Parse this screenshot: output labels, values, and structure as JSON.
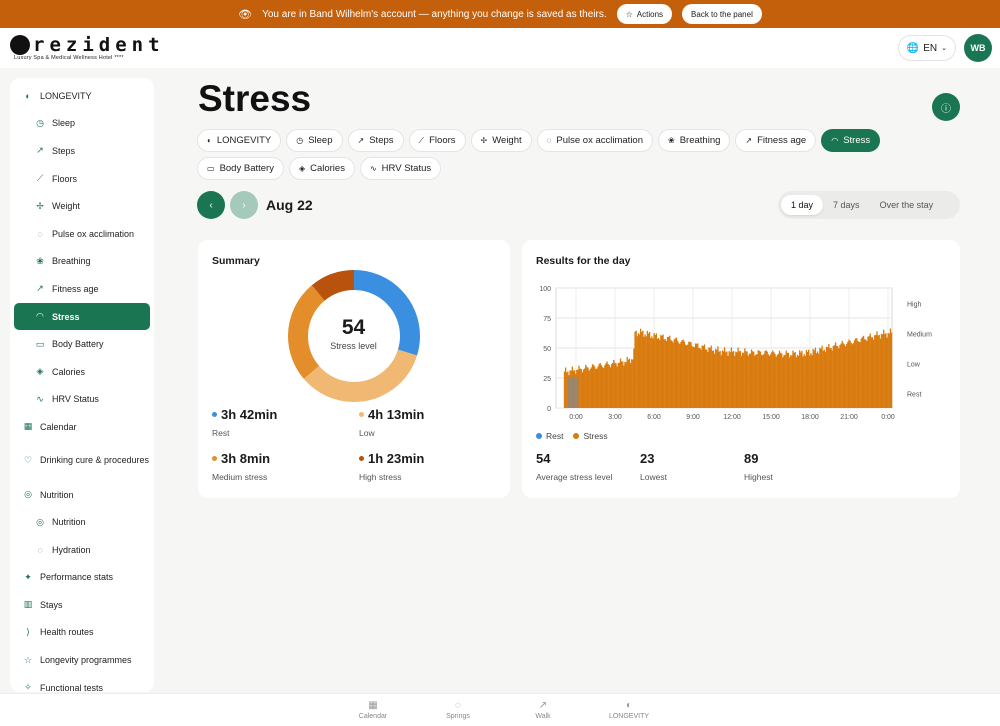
{
  "banner": {
    "message": "You are in Band Wilhelm's account — anything you change is saved as theirs.",
    "actions_label": "Actions",
    "back_label": "Back to the panel"
  },
  "header": {
    "logo_text": "rezident",
    "logo_sub": "Luxury Spa & Medical Wellness Hotel ****",
    "language": "EN",
    "avatar": "WB"
  },
  "sidebar": {
    "items": [
      {
        "label": "LONGEVITY",
        "icon": "longevity-icon",
        "glyph": "◐",
        "sub": false
      },
      {
        "label": "Sleep",
        "icon": "clock-icon",
        "glyph": "◷",
        "sub": true
      },
      {
        "label": "Steps",
        "icon": "walk-icon",
        "glyph": "↗",
        "sub": true
      },
      {
        "label": "Floors",
        "icon": "stairs-icon",
        "glyph": "⟋",
        "sub": true
      },
      {
        "label": "Weight",
        "icon": "weight-icon",
        "glyph": "✢",
        "sub": true
      },
      {
        "label": "Pulse ox acclimation",
        "icon": "drop-icon",
        "glyph": "◌",
        "sub": true
      },
      {
        "label": "Breathing",
        "icon": "lungs-icon",
        "glyph": "❀",
        "sub": true
      },
      {
        "label": "Fitness age",
        "icon": "runner-icon",
        "glyph": "↗",
        "sub": true
      },
      {
        "label": "Stress",
        "icon": "gauge-icon",
        "glyph": "◠",
        "sub": true,
        "active": true
      },
      {
        "label": "Body Battery",
        "icon": "battery-icon",
        "glyph": "▭",
        "sub": true
      },
      {
        "label": "Calories",
        "icon": "flame-icon",
        "glyph": "◈",
        "sub": true
      },
      {
        "label": "HRV Status",
        "icon": "pulse-icon",
        "glyph": "∿",
        "sub": true
      },
      {
        "label": "Calendar",
        "icon": "calendar-icon",
        "glyph": "▦",
        "sub": false
      },
      {
        "label": "Drinking cure & procedures",
        "icon": "heart-icon",
        "glyph": "♡",
        "sub": false,
        "two": true
      },
      {
        "label": "Nutrition",
        "icon": "target-icon",
        "glyph": "◎",
        "sub": false
      },
      {
        "label": "Nutrition",
        "icon": "target-icon",
        "glyph": "◎",
        "sub": true
      },
      {
        "label": "Hydration",
        "icon": "drop-icon",
        "glyph": "◌",
        "sub": true
      },
      {
        "label": "Performance stats",
        "icon": "sparkle-icon",
        "glyph": "✦",
        "sub": false
      },
      {
        "label": "Stays",
        "icon": "hotel-icon",
        "glyph": "▥",
        "sub": false
      },
      {
        "label": "Health routes",
        "icon": "route-icon",
        "glyph": "⟩",
        "sub": false
      },
      {
        "label": "Longevity programmes",
        "icon": "star-icon",
        "glyph": "☆",
        "sub": false
      },
      {
        "label": "Functional tests",
        "icon": "flask-icon",
        "glyph": "✧",
        "sub": false
      }
    ]
  },
  "page": {
    "title": "Stress",
    "date": "Aug 22",
    "period_tabs": [
      "1 day",
      "7 days",
      "Over the stay"
    ],
    "active_period": 0
  },
  "chips": [
    {
      "label": "LONGEVITY",
      "glyph": "◐"
    },
    {
      "label": "Sleep",
      "glyph": "◷"
    },
    {
      "label": "Steps",
      "glyph": "↗"
    },
    {
      "label": "Floors",
      "glyph": "⟋"
    },
    {
      "label": "Weight",
      "glyph": "✢"
    },
    {
      "label": "Pulse ox acclimation",
      "glyph": "◌"
    },
    {
      "label": "Breathing",
      "glyph": "❀"
    },
    {
      "label": "Fitness age",
      "glyph": "↗"
    },
    {
      "label": "Stress",
      "glyph": "◠",
      "active": true
    },
    {
      "label": "Body Battery",
      "glyph": "▭"
    },
    {
      "label": "Calories",
      "glyph": "◈"
    },
    {
      "label": "HRV Status",
      "glyph": "∿"
    }
  ],
  "summary": {
    "title": "Summary",
    "stress_level": "54",
    "stress_label": "Stress level",
    "segments": [
      {
        "name": "Rest",
        "minutes": 222,
        "color": "#3a8fe0",
        "value": "3h 42min"
      },
      {
        "name": "Low",
        "minutes": 253,
        "color": "#f0b872",
        "value": "4h 13min"
      },
      {
        "name": "Medium stress",
        "minutes": 188,
        "color": "#e38e2a",
        "value": "3h 8min"
      },
      {
        "name": "High stress",
        "minutes": 83,
        "color": "#b8520d",
        "value": "1h 23min"
      }
    ]
  },
  "results": {
    "title": "Results for the day",
    "legend": [
      {
        "name": "Rest",
        "color": "#3a8fe0"
      },
      {
        "name": "Stress",
        "color": "#d97b0e"
      }
    ],
    "stats": [
      {
        "value": "54",
        "label": "Average stress level"
      },
      {
        "value": "23",
        "label": "Lowest"
      },
      {
        "value": "89",
        "label": "Highest"
      }
    ]
  },
  "chart_data": {
    "type": "bar",
    "title": "Results for the day",
    "x_ticks": [
      "0:00",
      "3:00",
      "6:00",
      "9:00",
      "12:00",
      "15:00",
      "18:00",
      "21:00",
      "0:00"
    ],
    "y_ticks": [
      0,
      25,
      50,
      75,
      100
    ],
    "ylim": [
      0,
      100
    ],
    "right_labels": [
      "High",
      "Medium",
      "Low",
      "Rest"
    ],
    "grid": true,
    "series": [
      {
        "name": "Stress",
        "color": "#d97b0e",
        "profile": [
          [
            0.5,
            30
          ],
          [
            1.0,
            31
          ],
          [
            2.0,
            33
          ],
          [
            3.0,
            35
          ],
          [
            4.0,
            37
          ],
          [
            5.0,
            39
          ],
          [
            5.5,
            42
          ],
          [
            5.6,
            63
          ],
          [
            6.0,
            63
          ],
          [
            7.0,
            60
          ],
          [
            8.0,
            58
          ],
          [
            9.0,
            55
          ],
          [
            10.0,
            52
          ],
          [
            11.0,
            49
          ],
          [
            12.0,
            47
          ],
          [
            13.0,
            47
          ],
          [
            14.0,
            46
          ],
          [
            15.0,
            46
          ],
          [
            16.0,
            45
          ],
          [
            17.0,
            45
          ],
          [
            18.0,
            46
          ],
          [
            19.0,
            49
          ],
          [
            20.0,
            52
          ],
          [
            21.0,
            55
          ],
          [
            22.0,
            58
          ],
          [
            23.0,
            61
          ],
          [
            24.0,
            63
          ]
        ]
      },
      {
        "name": "Rest",
        "color": "#888888",
        "profile": [
          [
            0.8,
            25
          ],
          [
            1.6,
            25
          ]
        ]
      }
    ]
  },
  "bottom_tabs": [
    {
      "label": "Calendar",
      "glyph": "▦"
    },
    {
      "label": "Springs",
      "glyph": "◌"
    },
    {
      "label": "Walk",
      "glyph": "↗"
    },
    {
      "label": "LONGEVITY",
      "glyph": "◐"
    }
  ]
}
